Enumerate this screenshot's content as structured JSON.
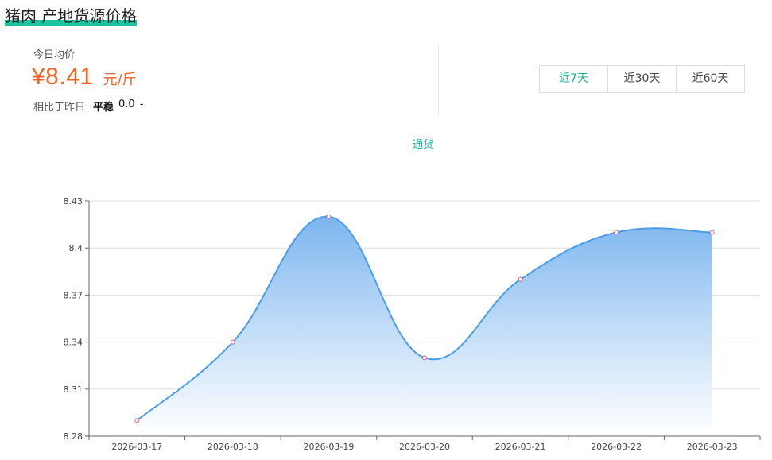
{
  "header": {
    "title": "猪肉 产地货源价格"
  },
  "summary": {
    "today_label": "今日均价",
    "price": "¥8.41",
    "unit": "元/斤",
    "compare_label": "相比于昨日",
    "compare_state": "平稳",
    "compare_value": "0.0",
    "compare_arrow": "-"
  },
  "tabs": [
    {
      "label": "近7天",
      "active": true
    },
    {
      "label": "近30天",
      "active": false
    },
    {
      "label": "近60天",
      "active": false
    }
  ],
  "colors": {
    "accent": "#19b394",
    "price": "#f26522",
    "line": "#4a9ee8",
    "area_top": "#7bb5ef",
    "area_bottom": "#ffffff",
    "point": "#e05a7a"
  },
  "chart_data": {
    "type": "area",
    "legend": [
      "通货"
    ],
    "series": [
      {
        "name": "通货",
        "values": [
          8.29,
          8.34,
          8.42,
          8.33,
          8.38,
          8.41,
          8.41
        ]
      }
    ],
    "x": [
      "2026-03-17",
      "2026-03-18",
      "2026-03-19",
      "2026-03-20",
      "2026-03-21",
      "2026-03-22",
      "2026-03-23"
    ],
    "y_ticks": [
      "8.28",
      "8.31",
      "8.34",
      "8.37",
      "8.4",
      "8.43"
    ],
    "ylim": [
      8.28,
      8.43
    ],
    "smooth": true,
    "grid": true,
    "legend_position": "top-center"
  }
}
